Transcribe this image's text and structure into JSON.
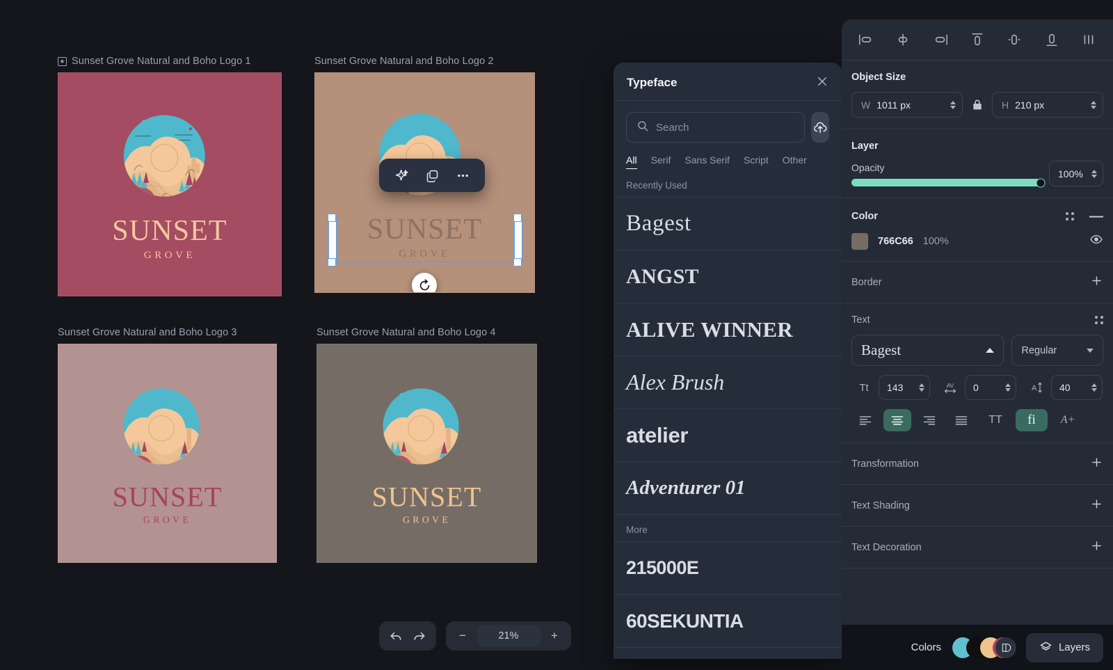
{
  "canvas": {
    "background": "#14161b",
    "cards": [
      {
        "label": "Sunset Grove Natural and Boho Logo 1",
        "starred": true,
        "bg": "#A34C62",
        "wordmark_color": "#F4C89A",
        "sub_color": "#F4C89A",
        "word": "SUNSET",
        "subword": "GROVE"
      },
      {
        "label": "Sunset Grove Natural and Boho Logo 2",
        "starred": false,
        "bg": "#B5907A",
        "wordmark_color": "#8C7264",
        "sub_color": "#8C7264",
        "word": "SUNSET",
        "subword": "GROVE"
      },
      {
        "label": "Sunset Grove Natural and Boho Logo 3",
        "starred": false,
        "bg": "#B39292",
        "wordmark_color": "#A8415E",
        "sub_color": "#A8415E",
        "word": "SUNSET",
        "subword": "GROVE"
      },
      {
        "label": "Sunset Grove Natural and Boho Logo 4",
        "starred": false,
        "bg": "#766C66",
        "wordmark_color": "#F0C48E",
        "sub_color": "#F0C48E",
        "word": "SUNSET",
        "subword": "GROVE"
      }
    ],
    "floating_toolbar": {
      "ai_label": "AI effects",
      "duplicate_label": "Duplicate",
      "more_label": "More options"
    },
    "rotate_label": "Rotate"
  },
  "zoom_bar": {
    "undo_label": "Undo",
    "redo_label": "Redo",
    "minus_label": "−",
    "plus_label": "+",
    "zoom_value": "21%"
  },
  "typeface_panel": {
    "title": "Typeface",
    "close_label": "×",
    "search_placeholder": "Search",
    "search_value": "",
    "upload_label": "Upload font",
    "tabs": [
      {
        "label": "All",
        "active": true
      },
      {
        "label": "Serif",
        "active": false
      },
      {
        "label": "Sans Serif",
        "active": false
      },
      {
        "label": "Script",
        "active": false
      },
      {
        "label": "Other",
        "active": false
      }
    ],
    "section_recent": "Recently Used",
    "recent_fonts": [
      "Bagest",
      "ANGST",
      "ALIVE WINNER",
      "Alex Brush",
      "atelier",
      "Adventurer 01"
    ],
    "section_more": "More",
    "more_fonts": [
      "215000E",
      "60SEKUNTIA"
    ]
  },
  "inspector": {
    "align_buttons": [
      "align-left",
      "align-center-horizontal",
      "align-right",
      "align-top",
      "align-middle-vertical",
      "align-bottom",
      "distribute-horizontal"
    ],
    "object_size": {
      "title": "Object Size",
      "width_label": "W",
      "width_value": "1011 px",
      "height_label": "H",
      "height_value": "210 px",
      "lock_label": "Lock aspect ratio"
    },
    "layer": {
      "title": "Layer",
      "opacity_label": "Opacity",
      "opacity_value": "100%",
      "opacity_percent": 100,
      "slider_color": "#7ddcc0"
    },
    "color": {
      "title": "Color",
      "hex": "766C66",
      "swatch": "#766C66",
      "opacity": "100%",
      "visibility_label": "Toggle visibility"
    },
    "border": {
      "title": "Border",
      "add_label": "+"
    },
    "text": {
      "title": "Text",
      "font_family": "Bagest",
      "font_weight": "Regular",
      "font_size_label": "Tt",
      "font_size": "143",
      "letter_spacing_label": "AV",
      "letter_spacing": "0",
      "line_height_label": "A↕",
      "line_height": "40",
      "align_options": [
        "align-left",
        "align-center",
        "align-right",
        "align-justify"
      ],
      "align_active": "align-center",
      "uppercase_label": "TT",
      "ligature_label": "fi",
      "ligature_active": true,
      "more_type_label": "A+"
    },
    "transformation": {
      "title": "Transformation",
      "add_label": "+"
    },
    "text_shading": {
      "title": "Text Shading",
      "add_label": "+"
    },
    "text_decoration": {
      "title": "Text Decoration",
      "add_label": "+"
    }
  },
  "dock": {
    "colors_label": "Colors",
    "palette": [
      "#5FC0CE",
      "#120E0E",
      "#F0C48E",
      "#A8415E"
    ],
    "layers_label": "Layers"
  }
}
